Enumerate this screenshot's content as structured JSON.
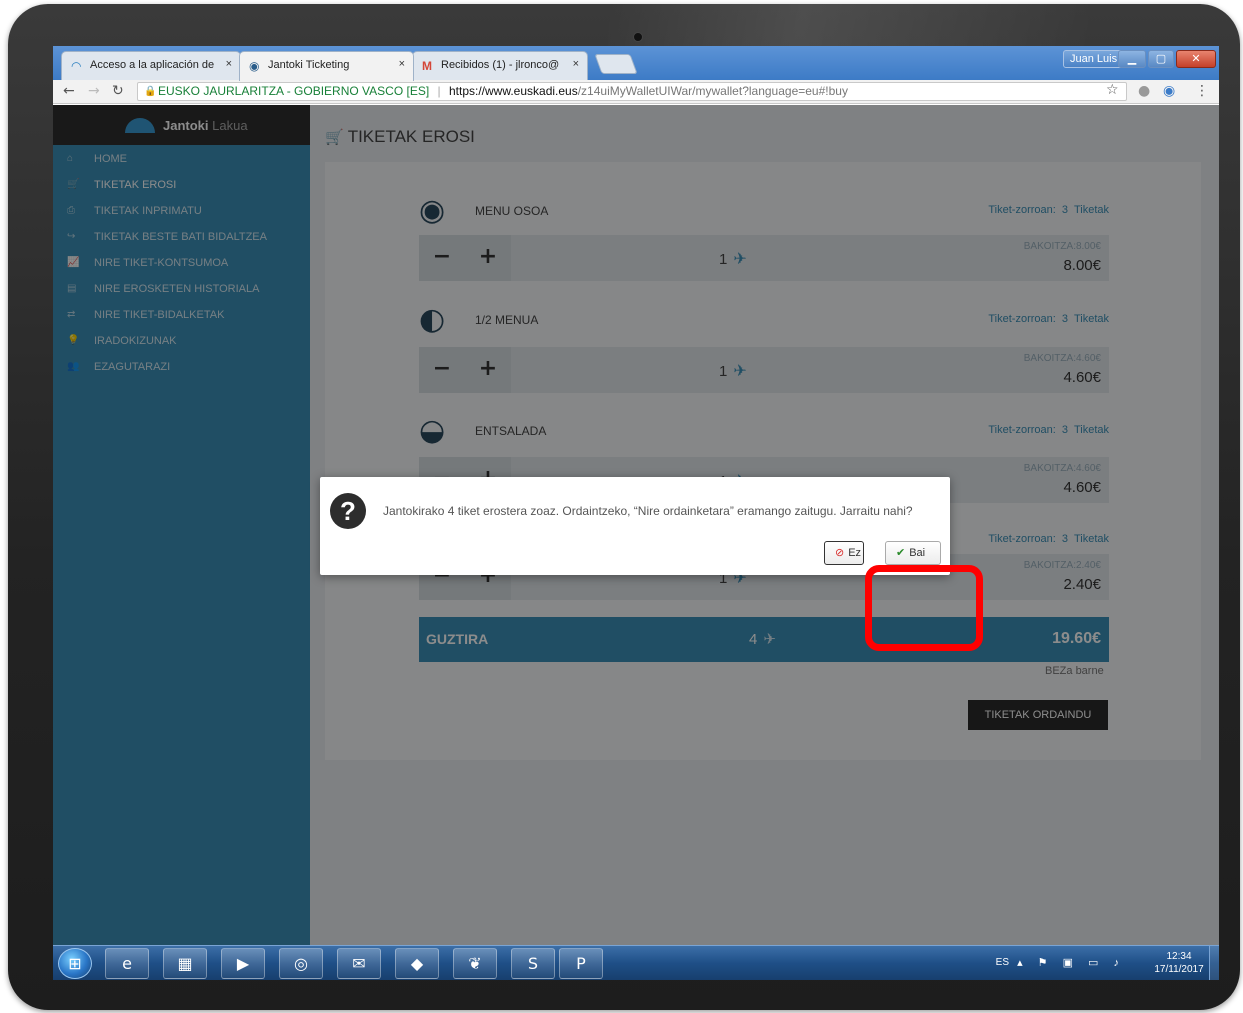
{
  "browser": {
    "tabs": [
      {
        "label": "Acceso a la aplicación de",
        "icon": "arc-logo-icon"
      },
      {
        "label": "Jantoki Ticketing",
        "icon": "plate-icon"
      },
      {
        "label": "Recibidos (1) - jlronco@",
        "icon": "gmail-icon"
      }
    ],
    "close_glyph": "×",
    "window_user": "Juan Luis",
    "address": {
      "org": "EUSKO JAURLARITZA - GOBIERNO VASCO [ES]",
      "host": "https://www.euskadi.eus",
      "path": "/z14uiMyWalletUIWar/mywallet?language=eu#!buy"
    }
  },
  "sidebar": {
    "brand_bold": "Jantoki",
    "brand_light": "Lakua",
    "items": [
      {
        "label": "HOME",
        "icon": "home-icon"
      },
      {
        "label": "TIKETAK EROSI",
        "icon": "cart-icon"
      },
      {
        "label": "TIKETAK INPRIMATU",
        "icon": "print-icon"
      },
      {
        "label": "TIKETAK BESTE BATI BIDALTZEA",
        "icon": "share-icon"
      },
      {
        "label": "NIRE TIKET-KONTSUMOA",
        "icon": "chart-icon"
      },
      {
        "label": "NIRE EROSKETEN HISTORIALA",
        "icon": "list-icon"
      },
      {
        "label": "NIRE TIKET-BIDALKETAK",
        "icon": "transfer-icon"
      },
      {
        "label": "IRADOKIZUNAK",
        "icon": "bulb-icon"
      },
      {
        "label": "EZAGUTARAZI",
        "icon": "users-icon"
      }
    ]
  },
  "main": {
    "title": "TIKETAK EROSI",
    "wallet_label": "Tiket-zorroan:",
    "wallet_suffix": "Tiketak",
    "unit_label": "BAKOITZA:",
    "products": [
      {
        "name": "MENU OSOA",
        "wallet": "3",
        "qty": "1",
        "unit_price": "8.00€",
        "price": "8.00€",
        "icon": "plate-icon"
      },
      {
        "name": "1/2 MENUA",
        "wallet": "3",
        "qty": "1",
        "unit_price": "4.60€",
        "price": "4.60€",
        "icon": "half-plate-icon"
      },
      {
        "name": "ENTSALADA",
        "wallet": "3",
        "qty": "1",
        "unit_price": "4.60€",
        "price": "4.60€",
        "icon": "salad-icon"
      },
      {
        "name": "",
        "wallet": "3",
        "qty": "1",
        "unit_price": "2.40€",
        "price": "2.40€",
        "icon": ""
      }
    ],
    "minus": "−",
    "plus": "+",
    "total_label": "GUZTIRA",
    "total_qty": "4",
    "total_price": "19.60€",
    "vat_note": "BEZa barne",
    "pay_button": "TIKETAK ORDAINDU"
  },
  "dialog": {
    "message": "Jantokirako 4 tiket erostera zoaz. Ordaintzeko, “Nire ordainketara” eramango zaitugu. Jarraitu nahi?",
    "no_label": "Ez",
    "yes_label": "Bai",
    "highlight_color": "#ff0000"
  },
  "taskbar": {
    "apps": [
      "ie-icon",
      "explorer-icon",
      "media-icon",
      "chrome-icon",
      "outlook-icon",
      "notes-icon",
      "butterfly-icon",
      "skype-icon",
      "powerpoint-icon"
    ],
    "lang": "ES",
    "time": "12:34",
    "date": "17/11/2017"
  },
  "colors": {
    "sidebar": "#3b8fb6",
    "accent": "#3b8fb6",
    "dark": "#2b2b2b"
  }
}
